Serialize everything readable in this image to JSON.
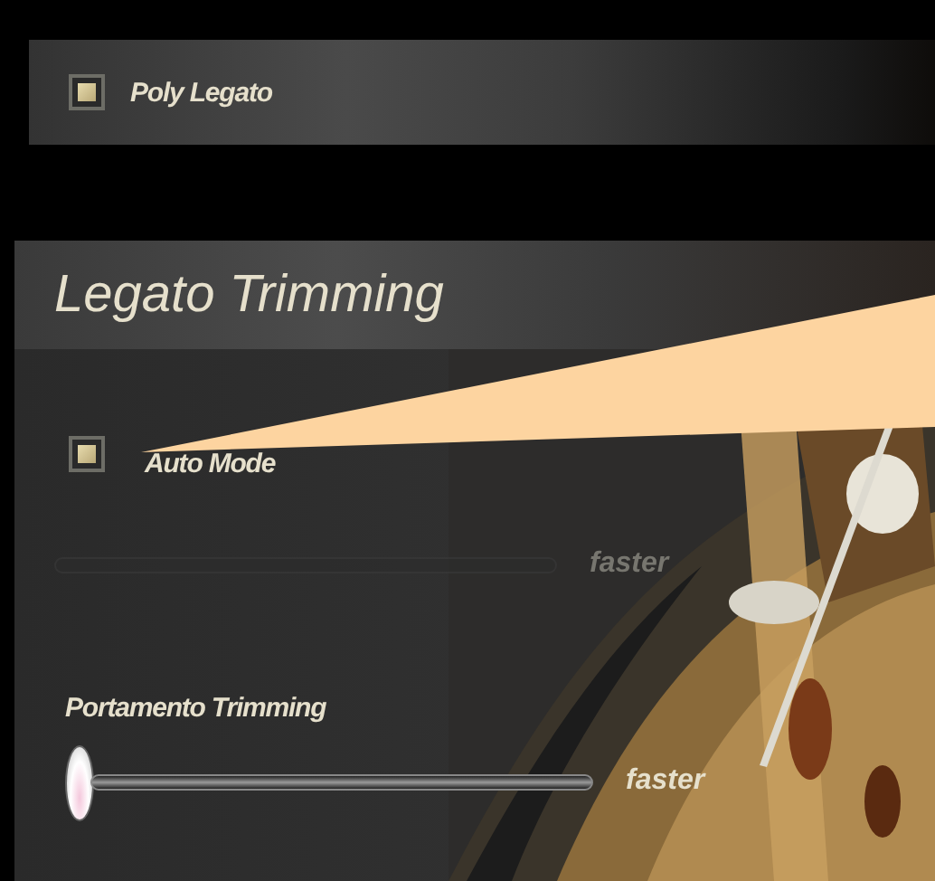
{
  "top_panel": {
    "checkbox": {
      "label": "Poly Legato",
      "checked": true
    }
  },
  "legato_trimming": {
    "title": "Legato Trimming",
    "auto_mode": {
      "label": "Auto Mode",
      "checked": true
    },
    "trim_slider": {
      "disabled": true,
      "end_label": "faster"
    },
    "portamento": {
      "label": "Portamento Trimming",
      "level": 0,
      "end_label": "faster"
    }
  },
  "callout": {
    "kind": "pointer"
  }
}
